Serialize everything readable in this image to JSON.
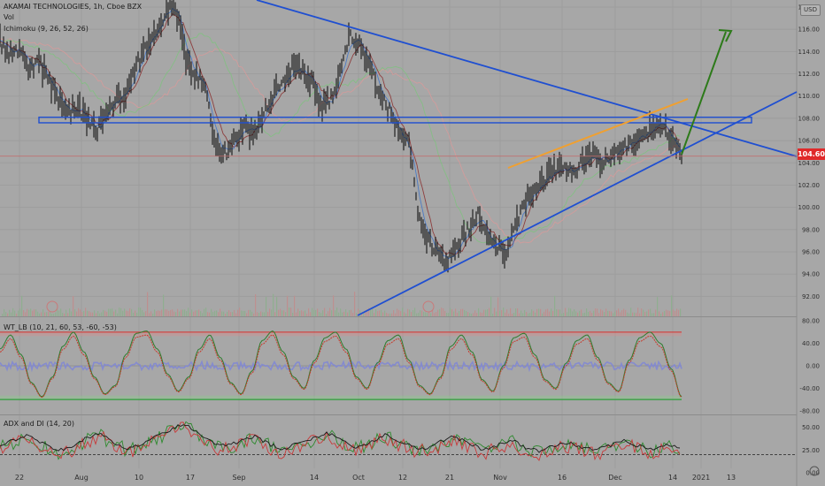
{
  "header": {
    "symbol_line": "AKAMAI TECHNOLOGIES, 1h, Cboe BZX",
    "volume_label": "Vol",
    "ichimoku_label": "Ichimoku (9, 26, 52, 26)"
  },
  "currency": "USD",
  "last_price_label": "104.60",
  "colors": {
    "background": "#a7a7a7",
    "trendline": "#1f4fd1",
    "price": "#151515",
    "overbought": "#d8302c",
    "oversold": "#2f9d3a",
    "forecast_arrow": "#2d7a1a",
    "upper_trend": "#f0a030",
    "last_price_tag": "#e0292a"
  },
  "chart_data": [
    {
      "type": "line",
      "pane": "price",
      "title": "AKAMAI TECHNOLOGIES, 1h, Cboe BZX",
      "ylim": [
        91,
        118
      ],
      "y_ticks": [
        "118.00",
        "116.00",
        "114.00",
        "112.00",
        "110.00",
        "108.00",
        "106.00",
        "104.00",
        "102.00",
        "100.00",
        "98.00",
        "96.00",
        "94.00",
        "92.00"
      ],
      "x_ticks": [
        "22",
        "Aug",
        "10",
        "17",
        "Sep",
        "14",
        "Oct",
        "12",
        "21",
        "Nov",
        "16",
        "Dec",
        "14",
        "2021",
        "13"
      ],
      "series": [
        {
          "values": [
            115,
            113.6,
            114.4,
            112.5,
            113.2,
            111.2,
            109.8,
            108.4,
            109.2,
            107.6,
            106.9,
            108.8,
            109.6,
            110.4,
            112.6,
            114.5,
            116,
            117.6,
            118.2,
            113.5,
            112,
            110.8,
            106.2,
            104.8,
            105.8,
            107.2,
            106.5,
            108.4,
            110.2,
            111,
            112.6,
            112.2,
            111.4,
            109.2,
            109.6,
            112.6,
            115.6,
            114.4,
            112.8,
            110.4,
            108.6,
            106.4,
            105.6,
            99.2,
            97,
            95.8,
            95.1,
            96.6,
            97.8,
            99.4,
            97.5,
            96.4,
            95.7,
            98.6,
            100.6,
            101.6,
            102.6,
            103.3,
            103.6,
            103.1,
            104.2,
            104.6,
            104.1,
            104.8,
            105.2,
            106,
            106.5,
            107.2,
            107.6,
            106,
            104.8
          ]
        }
      ],
      "last_price": 104.6,
      "levels": {
        "horizontal_zone": [
          107.6,
          108.1
        ]
      },
      "annotations": [
        "descending trendline",
        "rising support trendline",
        "rising resistance line",
        "projected breakout arrow"
      ]
    },
    {
      "type": "line",
      "pane": "oscillator",
      "title": "WT_LB (10, 21, 60, 53, -60, -53)",
      "ylim": [
        -85,
        85
      ],
      "y_ticks": [
        "80.00",
        "40.00",
        "0.00",
        "-40.00",
        "-80.00"
      ],
      "levels": [
        60,
        53,
        -53,
        -60
      ],
      "series": [
        {
          "values": [
            30,
            55,
            20,
            -30,
            -55,
            -20,
            35,
            60,
            25,
            -20,
            -50,
            -35,
            20,
            58,
            62,
            30,
            -15,
            -45,
            -20,
            30,
            55,
            15,
            -30,
            -50,
            -10,
            45,
            62,
            25,
            -20,
            -40,
            10,
            50,
            60,
            30,
            -20,
            -40,
            5,
            45,
            55,
            10,
            -35,
            -50,
            -20,
            35,
            55,
            25,
            -25,
            -45,
            0,
            50,
            58,
            20,
            -25,
            -40,
            5,
            45,
            55,
            15,
            -30,
            -45,
            10,
            50,
            60,
            40,
            -5,
            -55
          ]
        }
      ]
    },
    {
      "type": "line",
      "pane": "adx",
      "title": "ADX and DI (14, 20)",
      "ylim": [
        5,
        62
      ],
      "y_ticks": [
        "50.00",
        "25.00",
        "0.00"
      ],
      "levels": [
        20
      ],
      "series": [
        {
          "values": [
            28,
            34,
            40,
            30,
            22,
            27,
            35,
            42,
            31,
            25,
            30,
            38,
            45,
            52,
            40,
            30,
            28,
            33,
            38,
            29,
            24,
            30,
            36,
            42,
            35,
            26,
            30,
            40,
            34,
            27,
            25,
            32,
            38,
            30,
            24,
            28,
            34,
            26,
            22,
            27,
            31,
            26,
            23,
            28,
            33,
            27,
            24,
            30,
            26
          ]
        }
      ]
    }
  ]
}
